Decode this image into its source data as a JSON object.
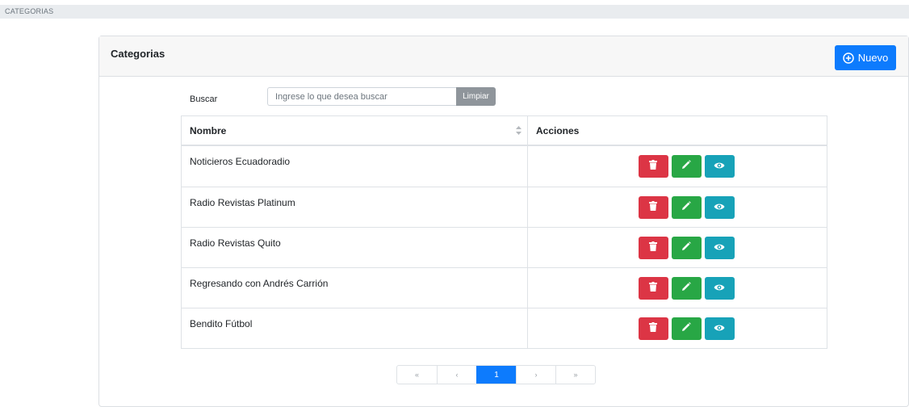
{
  "breadcrumb": "CATEGORIAS",
  "card": {
    "title": "Categorias",
    "new_button_label": "Nuevo"
  },
  "search": {
    "label": "Buscar",
    "placeholder": "Ingrese lo que desea buscar",
    "value": "",
    "clear_label": "Limpiar"
  },
  "table": {
    "headers": [
      "Nombre",
      "Acciones"
    ],
    "rows": [
      {
        "nombre": "Noticieros Ecuadoradio"
      },
      {
        "nombre": "Radio Revistas Platinum"
      },
      {
        "nombre": "Radio Revistas Quito"
      },
      {
        "nombre": "Regresando con Andrés Carrión"
      },
      {
        "nombre": "Bendito Fútbol"
      }
    ],
    "row_actions": [
      {
        "icon": "trash-icon",
        "color": "#dc3545"
      },
      {
        "icon": "pencil-icon",
        "color": "#28a745"
      },
      {
        "icon": "eye-icon",
        "color": "#17a2b8"
      }
    ]
  },
  "pagination": {
    "first": "«",
    "prev": "‹",
    "current": "1",
    "next": "›",
    "last": "»"
  },
  "colors": {
    "primary": "#0d7bfd",
    "danger": "#dc3545",
    "success": "#28a745",
    "info": "#17a2b8",
    "secondary": "#8f959b"
  }
}
